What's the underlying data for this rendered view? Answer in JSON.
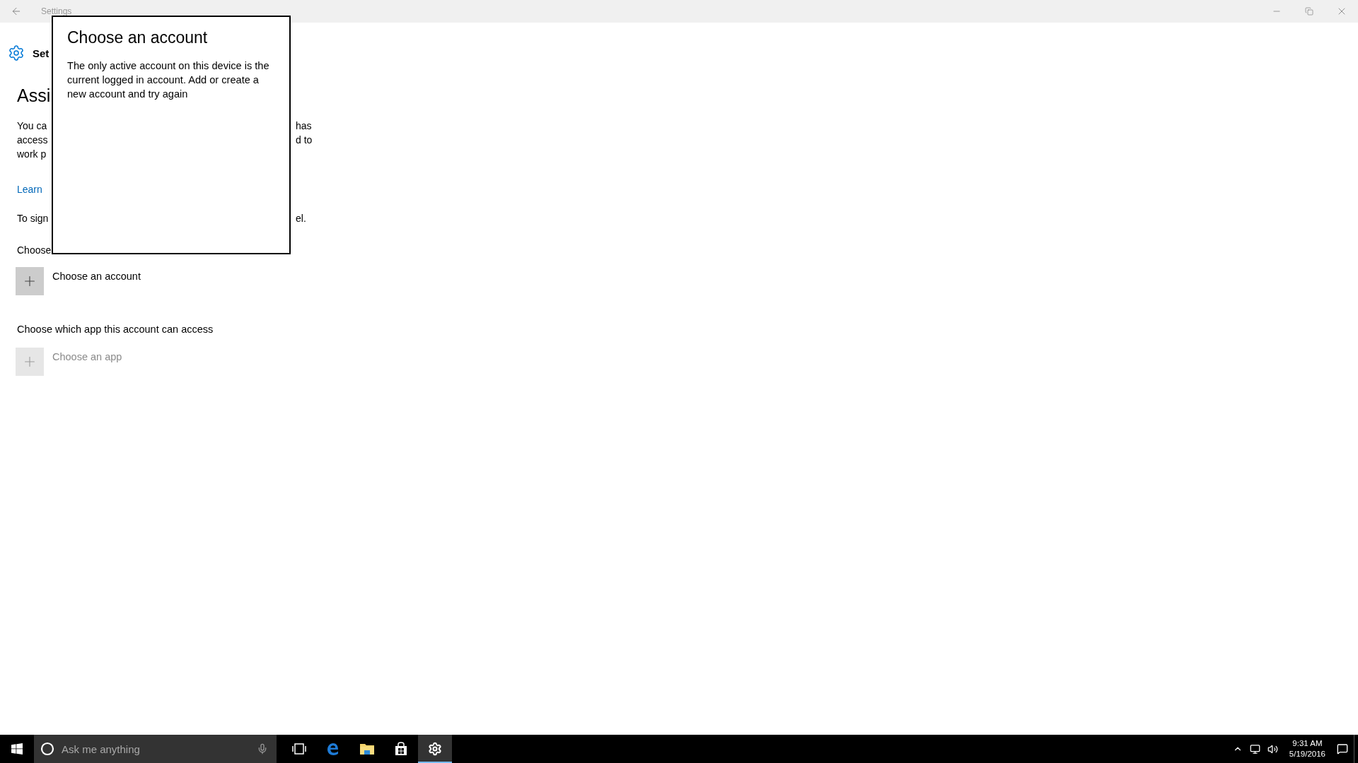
{
  "window": {
    "title": "Settings"
  },
  "header": {
    "title": "Set"
  },
  "page_heading": "Assi",
  "description_lines": [
    {
      "left": "You ca",
      "right": "has"
    },
    {
      "left": "access",
      "right": "d to"
    },
    {
      "left": "work p"
    }
  ],
  "learn_more_link": "Learn",
  "sign_in_line": {
    "left": "To sign",
    "right": "el."
  },
  "account_section_label": "Choose",
  "account_picker": {
    "label": "Choose an account",
    "disabled": false
  },
  "app_section_label": "Choose which app this account can access",
  "app_picker": {
    "label": "Choose an app",
    "disabled": true
  },
  "dialog": {
    "title": "Choose an account",
    "message": "The only active account on this device is the current logged in account. Add or create a new account and try again"
  },
  "taskbar": {
    "search_placeholder": "Ask me anything",
    "apps": [
      {
        "kind": "task-view",
        "selected": false
      },
      {
        "kind": "browser",
        "selected": false
      },
      {
        "kind": "files",
        "selected": false
      },
      {
        "kind": "store",
        "selected": false
      },
      {
        "kind": "settings",
        "selected": true
      }
    ],
    "clock": {
      "time": "9:31 AM",
      "date": "5/19/2016"
    }
  }
}
